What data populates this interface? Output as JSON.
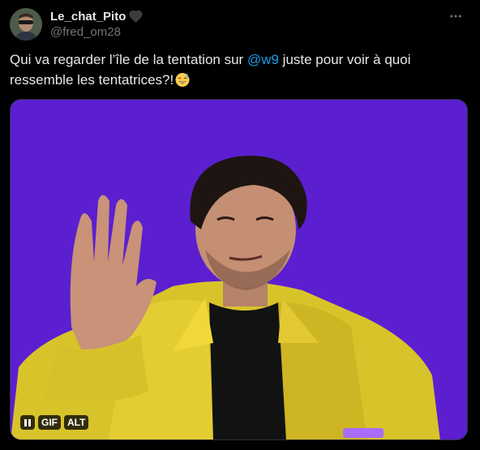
{
  "tweet": {
    "display_name": "Le_chat_Pito",
    "handle": "@fred_om28",
    "text_before_mention": "Qui va regarder l’île de la tentation sur ",
    "mention": "@w9",
    "text_after_mention": " juste pour voir à quoi ressemble les tentatrices?!",
    "emoji": "sweat-smile-emoji",
    "badge_icon": "black-heart-icon"
  },
  "media": {
    "type": "gif",
    "gif_label": "GIF",
    "alt_label": "ALT",
    "background_color": "#5b1fd0"
  },
  "colors": {
    "background": "#000000",
    "text": "#e7e9ea",
    "secondary_text": "#71767b",
    "link": "#1d9bf0"
  }
}
